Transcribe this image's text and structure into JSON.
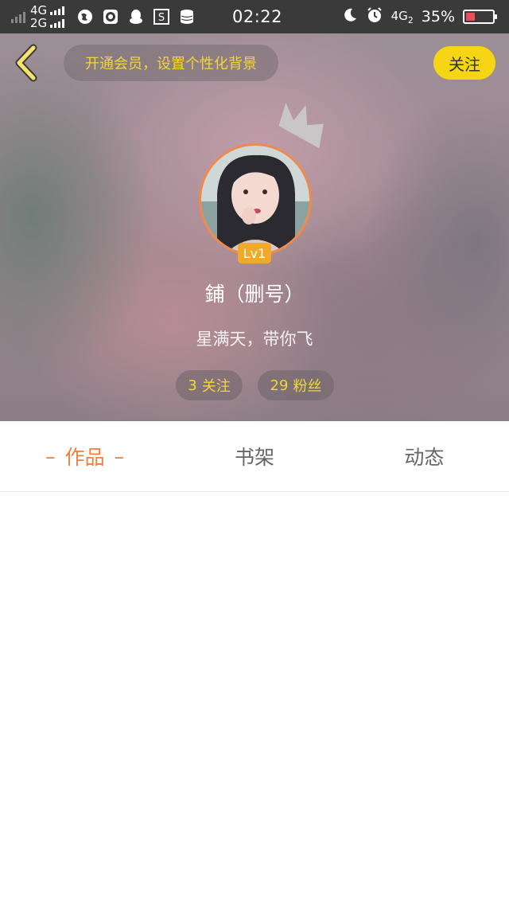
{
  "status_bar": {
    "network_top": "4G",
    "network_bottom": "2G",
    "time": "02:22",
    "network_right": "4G",
    "network_right_sub": "2",
    "battery_percent": "35%",
    "battery_level": 0.35,
    "icons": [
      "browser-icon",
      "browser-icon-2",
      "qq-icon",
      "s-app-icon",
      "storage-icon",
      "moon-icon",
      "alarm-icon"
    ]
  },
  "header": {
    "back_icon": "chevron-left-icon",
    "vip_prompt": "开通会员，设置个性化背景",
    "follow_label": "关注",
    "colors": {
      "accent_yellow": "#f6d515",
      "accent_orange": "#f07e3c"
    }
  },
  "profile": {
    "level": "Lv1",
    "username": "鋪（删号）",
    "bio": "星满天，带你飞",
    "following_count": "3",
    "following_label": "关注",
    "fans_count": "29",
    "fans_label": "粉丝"
  },
  "tabs": {
    "dash": "–",
    "items": [
      {
        "label": "作品",
        "active": true
      },
      {
        "label": "书架",
        "active": false
      },
      {
        "label": "动态",
        "active": false
      }
    ]
  }
}
